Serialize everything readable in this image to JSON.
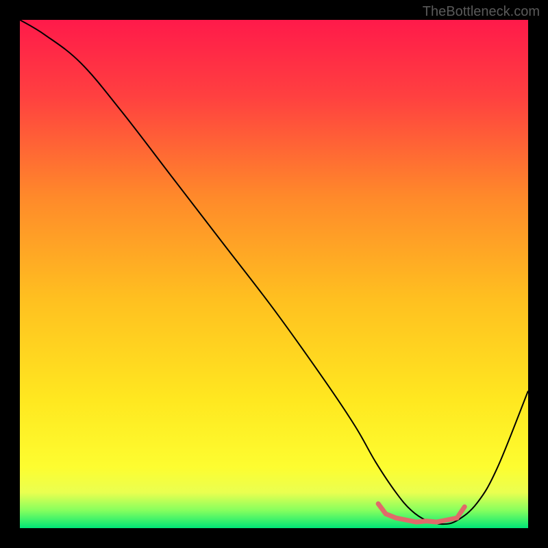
{
  "watermark": "TheBottleneck.com",
  "chart_data": {
    "type": "line",
    "title": "",
    "xlabel": "",
    "ylabel": "",
    "xlim": [
      0,
      100
    ],
    "ylim": [
      0,
      100
    ],
    "grid": false,
    "background": {
      "type": "vertical_gradient",
      "stops": [
        {
          "offset": 0.0,
          "color": "#ff1a4a"
        },
        {
          "offset": 0.15,
          "color": "#ff4040"
        },
        {
          "offset": 0.35,
          "color": "#ff8a2a"
        },
        {
          "offset": 0.55,
          "color": "#ffc020"
        },
        {
          "offset": 0.75,
          "color": "#ffe820"
        },
        {
          "offset": 0.88,
          "color": "#fdfd30"
        },
        {
          "offset": 0.93,
          "color": "#eaff50"
        },
        {
          "offset": 0.965,
          "color": "#86ff5e"
        },
        {
          "offset": 1.0,
          "color": "#00e676"
        }
      ]
    },
    "series": [
      {
        "name": "curve",
        "color": "#000000",
        "width": 2,
        "x": [
          0,
          5,
          12,
          20,
          30,
          40,
          50,
          60,
          66,
          70,
          74,
          77,
          80,
          83,
          86,
          90,
          94,
          100
        ],
        "y": [
          100,
          97,
          91.5,
          82,
          69,
          56,
          43,
          29,
          20,
          13,
          7,
          3.5,
          1.5,
          0.8,
          1.5,
          5,
          12,
          27
        ]
      },
      {
        "name": "optimal-band",
        "color": "#e06a6a",
        "width": 7,
        "x": [
          70.5,
          72,
          74,
          76,
          78,
          80,
          82,
          84,
          86,
          87.5
        ],
        "y": [
          4.8,
          2.8,
          2.0,
          1.6,
          1.2,
          1.4,
          1.2,
          1.6,
          2.0,
          4.2
        ]
      }
    ]
  }
}
